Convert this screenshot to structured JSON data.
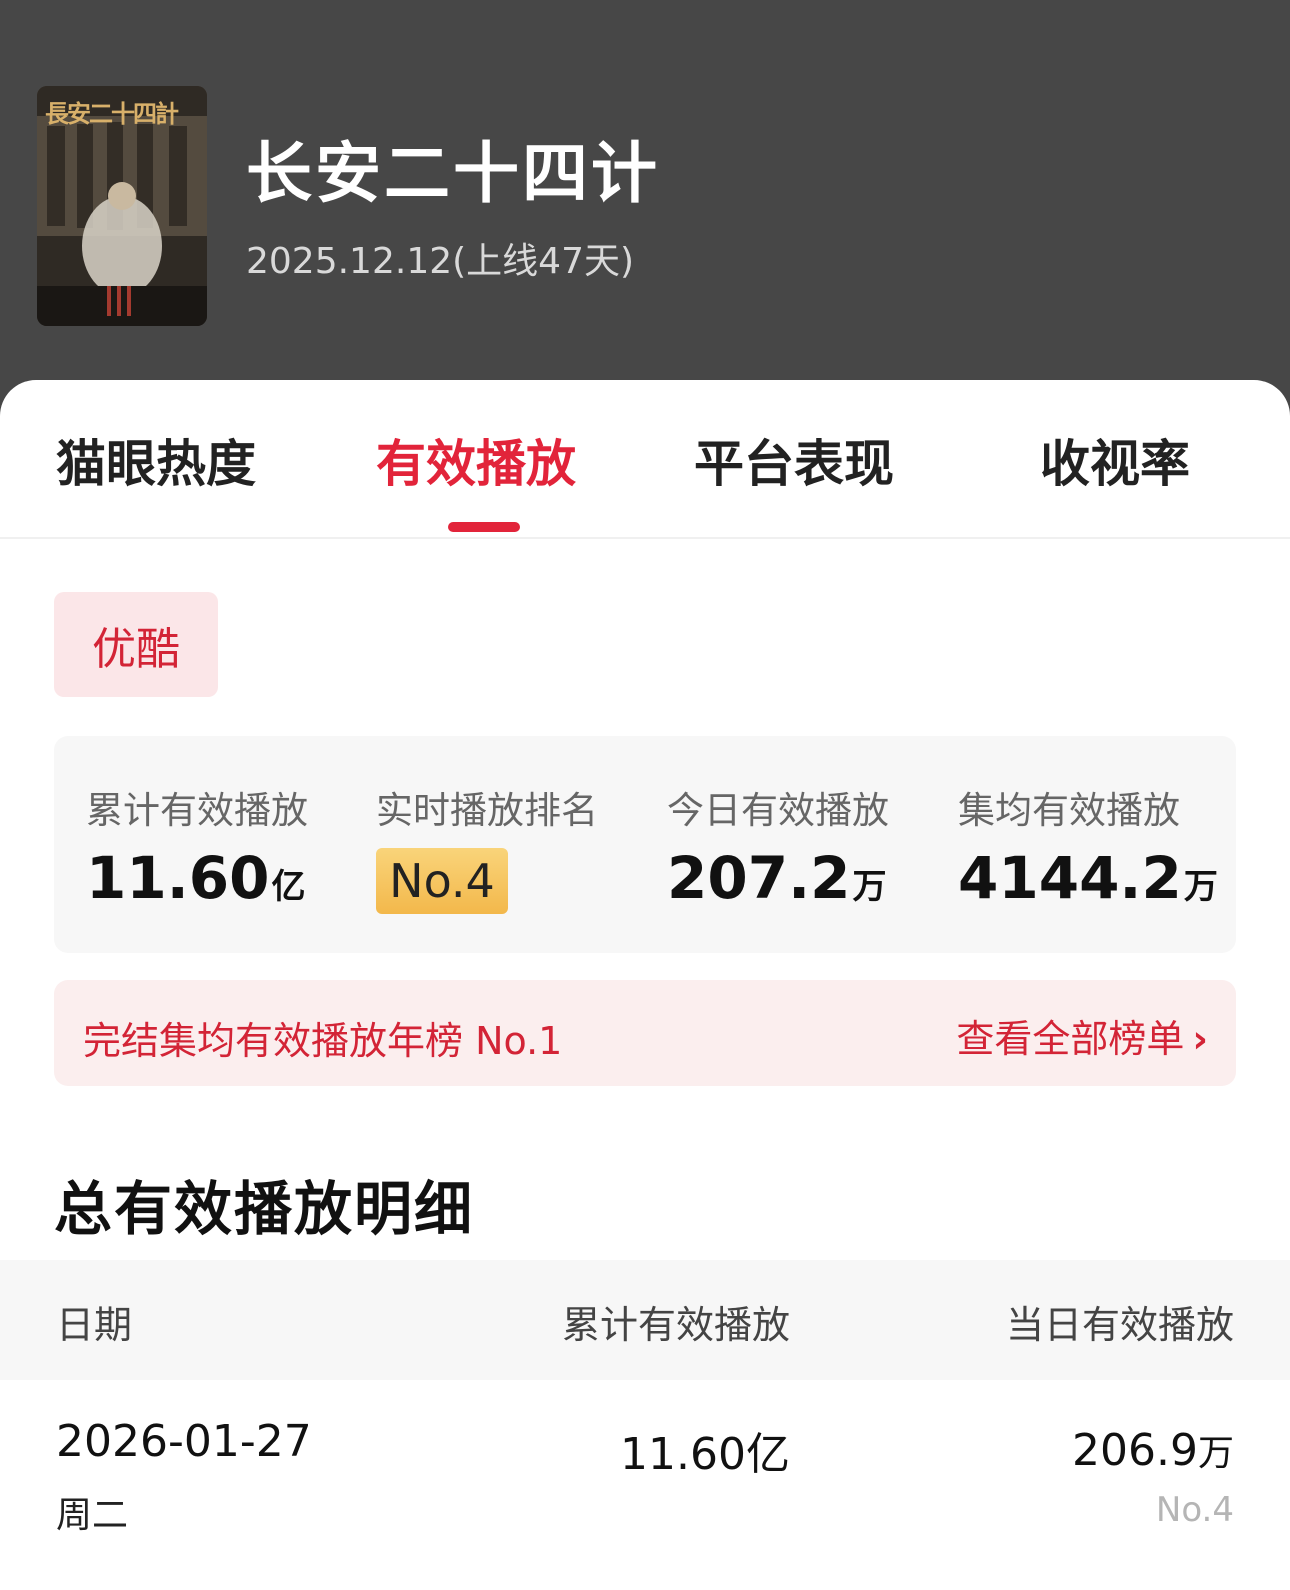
{
  "show": {
    "poster_title": "長安二十四計",
    "title": "长安二十四计",
    "subtitle": "2025.12.12(上线47天)"
  },
  "tabs": [
    {
      "label": "猫眼热度",
      "active": false
    },
    {
      "label": "有效播放",
      "active": true
    },
    {
      "label": "平台表现",
      "active": false
    },
    {
      "label": "收视率",
      "active": false
    }
  ],
  "platform": "优酷",
  "stats": {
    "cumulative": {
      "label": "累计有效播放",
      "value": "11.60",
      "unit": "亿"
    },
    "rank": {
      "label": "实时播放排名",
      "value": "No.4"
    },
    "today": {
      "label": "今日有效播放",
      "value": "207.2",
      "unit": "万"
    },
    "per_episode": {
      "label": "集均有效播放",
      "value": "4144.2",
      "unit": "万"
    }
  },
  "award": {
    "text": "完结集均有效播放年榜 No.1",
    "link": "查看全部榜单",
    "link_icon": "chevron-right-icon"
  },
  "section_title": "总有效播放明细",
  "table": {
    "headers": [
      "日期",
      "累计有效播放",
      "当日有效播放"
    ],
    "rows": [
      {
        "date": "2026-01-27",
        "weekday": "周二",
        "cumulative": "11.60亿",
        "daily_value": "206.9",
        "daily_unit": "万",
        "daily_rank": "No.4"
      }
    ]
  },
  "colors": {
    "accent": "#e2243a",
    "header_bg": "#474747",
    "badge_gold": "#f3b84b",
    "chip_bg": "#fbe6e8"
  }
}
